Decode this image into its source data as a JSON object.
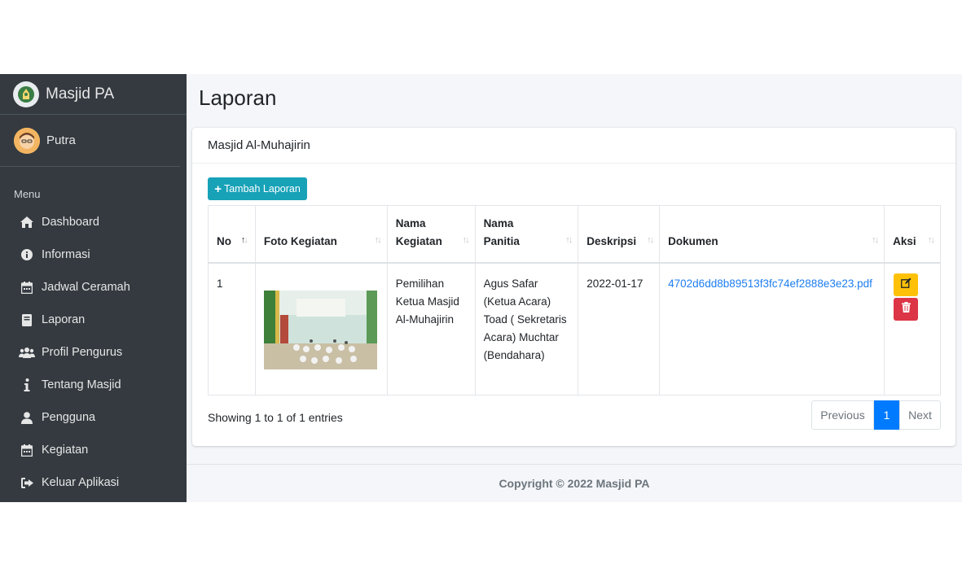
{
  "sidebar": {
    "brand": "Masjid PA",
    "user": "Putra",
    "menu_header": "Menu",
    "items": [
      {
        "label": "Dashboard",
        "icon": "home-icon"
      },
      {
        "label": "Informasi",
        "icon": "info-circle-icon"
      },
      {
        "label": "Jadwal Ceramah",
        "icon": "calendar-icon"
      },
      {
        "label": "Laporan",
        "icon": "book-icon"
      },
      {
        "label": "Profil Pengurus",
        "icon": "users-icon"
      },
      {
        "label": "Tentang Masjid",
        "icon": "info-icon"
      },
      {
        "label": "Pengguna",
        "icon": "user-icon"
      },
      {
        "label": "Kegiatan",
        "icon": "calendar-icon"
      },
      {
        "label": "Keluar Aplikasi",
        "icon": "sign-out-icon"
      }
    ]
  },
  "page": {
    "title": "Laporan",
    "card_title": "Masjid Al-Muhajirin",
    "add_button": "Tambah Laporan"
  },
  "table": {
    "headers": [
      "No",
      "Foto Kegiatan",
      "Nama Kegiatan",
      "Nama Panitia",
      "Deskripsi",
      "Dokumen",
      "Aksi"
    ],
    "rows": [
      {
        "no": "1",
        "nama_kegiatan": "Pemilihan Ketua Masjid Al-Muhajirin",
        "nama_panitia": "Agus Safar (Ketua Acara) Toad ( Sekretaris Acara) Muchtar (Bendahara)",
        "deskripsi": "2022-01-17",
        "dokumen": "4702d6dd8b89513f3fc74ef2888e3e23.pdf"
      }
    ]
  },
  "footer_info": "Showing 1 to 1 of 1 entries",
  "pagination": {
    "previous": "Previous",
    "current": "1",
    "next": "Next"
  },
  "copyright": "Copyright © 2022 Masjid PA",
  "colors": {
    "sidebar": "#343a40",
    "primary": "#007bff",
    "info": "#17a2b8",
    "warning": "#ffc107",
    "danger": "#dc3545"
  }
}
